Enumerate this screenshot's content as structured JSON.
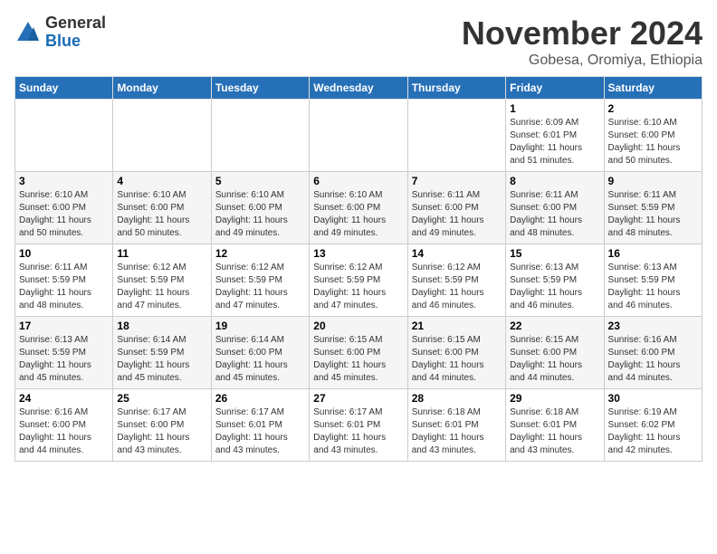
{
  "logo": {
    "general": "General",
    "blue": "Blue"
  },
  "title": "November 2024",
  "subtitle": "Gobesa, Oromiya, Ethiopia",
  "header_days": [
    "Sunday",
    "Monday",
    "Tuesday",
    "Wednesday",
    "Thursday",
    "Friday",
    "Saturday"
  ],
  "weeks": [
    [
      {
        "day": "",
        "info": ""
      },
      {
        "day": "",
        "info": ""
      },
      {
        "day": "",
        "info": ""
      },
      {
        "day": "",
        "info": ""
      },
      {
        "day": "",
        "info": ""
      },
      {
        "day": "1",
        "info": "Sunrise: 6:09 AM\nSunset: 6:01 PM\nDaylight: 11 hours\nand 51 minutes."
      },
      {
        "day": "2",
        "info": "Sunrise: 6:10 AM\nSunset: 6:00 PM\nDaylight: 11 hours\nand 50 minutes."
      }
    ],
    [
      {
        "day": "3",
        "info": "Sunrise: 6:10 AM\nSunset: 6:00 PM\nDaylight: 11 hours\nand 50 minutes."
      },
      {
        "day": "4",
        "info": "Sunrise: 6:10 AM\nSunset: 6:00 PM\nDaylight: 11 hours\nand 50 minutes."
      },
      {
        "day": "5",
        "info": "Sunrise: 6:10 AM\nSunset: 6:00 PM\nDaylight: 11 hours\nand 49 minutes."
      },
      {
        "day": "6",
        "info": "Sunrise: 6:10 AM\nSunset: 6:00 PM\nDaylight: 11 hours\nand 49 minutes."
      },
      {
        "day": "7",
        "info": "Sunrise: 6:11 AM\nSunset: 6:00 PM\nDaylight: 11 hours\nand 49 minutes."
      },
      {
        "day": "8",
        "info": "Sunrise: 6:11 AM\nSunset: 6:00 PM\nDaylight: 11 hours\nand 48 minutes."
      },
      {
        "day": "9",
        "info": "Sunrise: 6:11 AM\nSunset: 5:59 PM\nDaylight: 11 hours\nand 48 minutes."
      }
    ],
    [
      {
        "day": "10",
        "info": "Sunrise: 6:11 AM\nSunset: 5:59 PM\nDaylight: 11 hours\nand 48 minutes."
      },
      {
        "day": "11",
        "info": "Sunrise: 6:12 AM\nSunset: 5:59 PM\nDaylight: 11 hours\nand 47 minutes."
      },
      {
        "day": "12",
        "info": "Sunrise: 6:12 AM\nSunset: 5:59 PM\nDaylight: 11 hours\nand 47 minutes."
      },
      {
        "day": "13",
        "info": "Sunrise: 6:12 AM\nSunset: 5:59 PM\nDaylight: 11 hours\nand 47 minutes."
      },
      {
        "day": "14",
        "info": "Sunrise: 6:12 AM\nSunset: 5:59 PM\nDaylight: 11 hours\nand 46 minutes."
      },
      {
        "day": "15",
        "info": "Sunrise: 6:13 AM\nSunset: 5:59 PM\nDaylight: 11 hours\nand 46 minutes."
      },
      {
        "day": "16",
        "info": "Sunrise: 6:13 AM\nSunset: 5:59 PM\nDaylight: 11 hours\nand 46 minutes."
      }
    ],
    [
      {
        "day": "17",
        "info": "Sunrise: 6:13 AM\nSunset: 5:59 PM\nDaylight: 11 hours\nand 45 minutes."
      },
      {
        "day": "18",
        "info": "Sunrise: 6:14 AM\nSunset: 5:59 PM\nDaylight: 11 hours\nand 45 minutes."
      },
      {
        "day": "19",
        "info": "Sunrise: 6:14 AM\nSunset: 6:00 PM\nDaylight: 11 hours\nand 45 minutes."
      },
      {
        "day": "20",
        "info": "Sunrise: 6:15 AM\nSunset: 6:00 PM\nDaylight: 11 hours\nand 45 minutes."
      },
      {
        "day": "21",
        "info": "Sunrise: 6:15 AM\nSunset: 6:00 PM\nDaylight: 11 hours\nand 44 minutes."
      },
      {
        "day": "22",
        "info": "Sunrise: 6:15 AM\nSunset: 6:00 PM\nDaylight: 11 hours\nand 44 minutes."
      },
      {
        "day": "23",
        "info": "Sunrise: 6:16 AM\nSunset: 6:00 PM\nDaylight: 11 hours\nand 44 minutes."
      }
    ],
    [
      {
        "day": "24",
        "info": "Sunrise: 6:16 AM\nSunset: 6:00 PM\nDaylight: 11 hours\nand 44 minutes."
      },
      {
        "day": "25",
        "info": "Sunrise: 6:17 AM\nSunset: 6:00 PM\nDaylight: 11 hours\nand 43 minutes."
      },
      {
        "day": "26",
        "info": "Sunrise: 6:17 AM\nSunset: 6:01 PM\nDaylight: 11 hours\nand 43 minutes."
      },
      {
        "day": "27",
        "info": "Sunrise: 6:17 AM\nSunset: 6:01 PM\nDaylight: 11 hours\nand 43 minutes."
      },
      {
        "day": "28",
        "info": "Sunrise: 6:18 AM\nSunset: 6:01 PM\nDaylight: 11 hours\nand 43 minutes."
      },
      {
        "day": "29",
        "info": "Sunrise: 6:18 AM\nSunset: 6:01 PM\nDaylight: 11 hours\nand 43 minutes."
      },
      {
        "day": "30",
        "info": "Sunrise: 6:19 AM\nSunset: 6:02 PM\nDaylight: 11 hours\nand 42 minutes."
      }
    ]
  ]
}
